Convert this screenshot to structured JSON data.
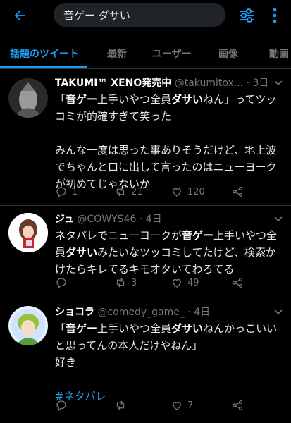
{
  "header": {
    "search_value": "音ゲー ダサい"
  },
  "tabs": [
    {
      "label": "話題のツイート"
    },
    {
      "label": "最新"
    },
    {
      "label": "ユーザー"
    },
    {
      "label": "画像"
    },
    {
      "label": "動画"
    }
  ],
  "tweets": [
    {
      "name": "TAKUMI™ XENO発売中",
      "handle": "@takumitox...",
      "time": "· 3日",
      "text_parts": [
        [
          "「",
          "音ゲー",
          "上手いやつ全員",
          "ダサい",
          "ねん」ってツッ"
        ],
        "コミが的確すぎて笑った",
        "",
        "みんな一度は思った事ありそうだけど、地上波",
        "でちゃんと口に出して言ったのはニューヨーク",
        "が初めてじゃないか"
      ],
      "replies": "1",
      "retweets": "21",
      "likes": "120"
    },
    {
      "name": "ジュ",
      "handle": "@COWYS46",
      "time": "· 4日",
      "text_parts": [
        [
          "ネタパレでニューヨークが",
          "音ゲー",
          "上手いやつ全"
        ],
        [
          "員",
          "ダサい",
          "みたいなツッコミしてたけど、検索か"
        ],
        "けたらキレてるキモオタいてわろてる"
      ],
      "replies": "",
      "retweets": "3",
      "likes": "49"
    },
    {
      "name": "ショコラ",
      "handle": "@comedy_game_",
      "time": "· 4日",
      "text_parts": [
        [
          "「",
          "音ゲー",
          "上手いやつ全員",
          "ダサい",
          "ねんかっこいい"
        ],
        "と思ってんの本人だけやねん」",
        "好き",
        ""
      ],
      "hashtag": "#ネタパレ",
      "replies": "",
      "retweets": "",
      "likes": "7"
    }
  ]
}
